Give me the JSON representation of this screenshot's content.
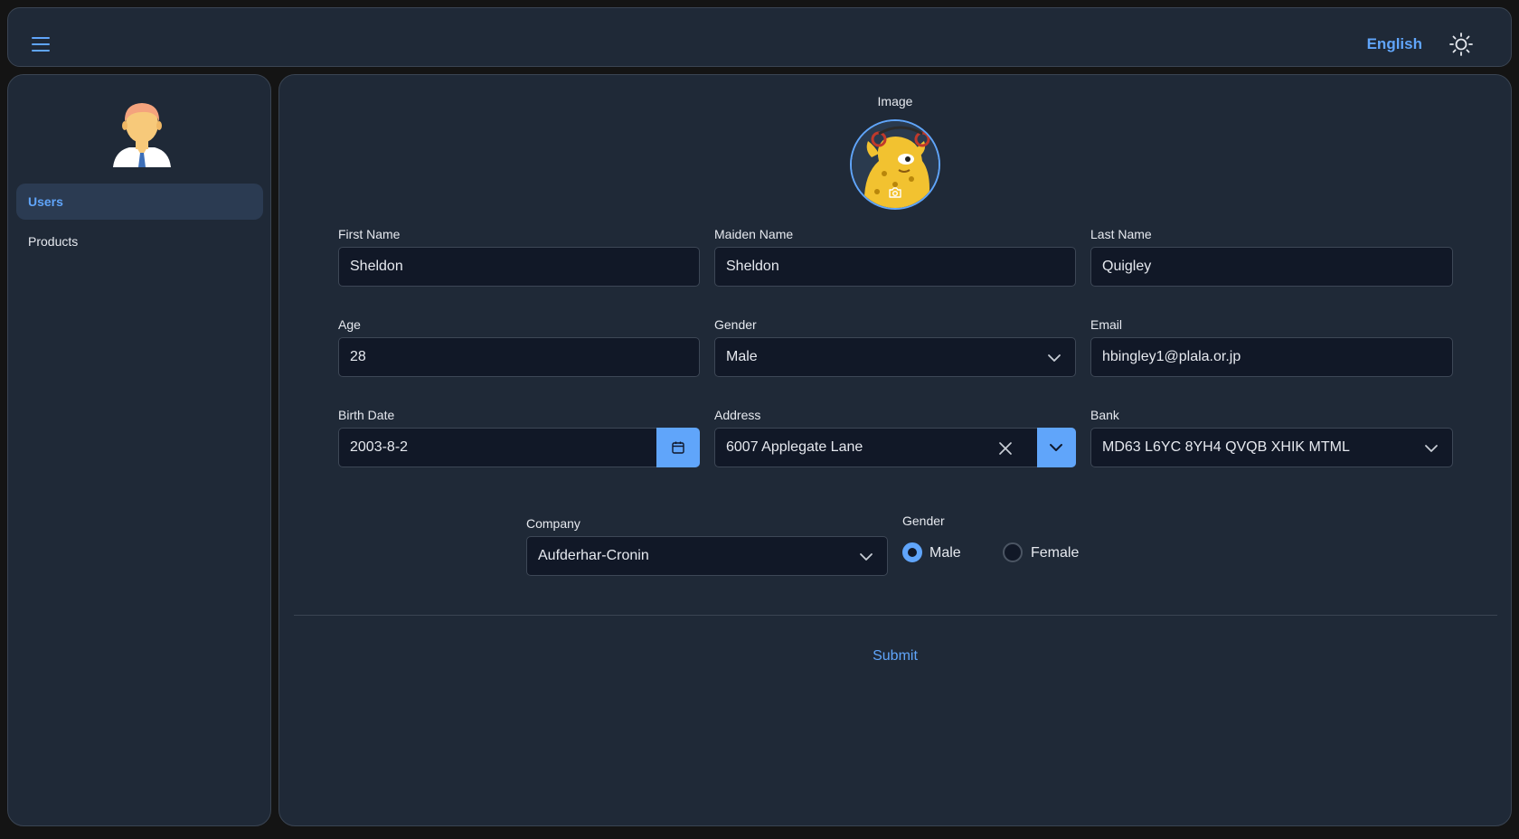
{
  "header": {
    "menu_icon": "hamburger-menu-icon",
    "language": "English",
    "theme_icon": "sun-icon"
  },
  "sidebar": {
    "avatar_icon": "user-avatar-icon",
    "items": [
      {
        "label": "Users",
        "active": true
      },
      {
        "label": "Products",
        "active": false
      }
    ]
  },
  "form": {
    "image_label": "Image",
    "camera_icon": "camera-icon",
    "first_name": {
      "label": "First Name",
      "value": "Sheldon"
    },
    "maiden_name": {
      "label": "Maiden Name",
      "value": "Sheldon"
    },
    "last_name": {
      "label": "Last Name",
      "value": "Quigley"
    },
    "age": {
      "label": "Age",
      "value": "28"
    },
    "gender_select": {
      "label": "Gender",
      "value": "Male"
    },
    "email": {
      "label": "Email",
      "value": "hbingley1@plala.or.jp"
    },
    "birth_date": {
      "label": "Birth Date",
      "value": "2003-8-2"
    },
    "address": {
      "label": "Address",
      "value": "6007 Applegate Lane"
    },
    "bank": {
      "label": "Bank",
      "value": "MD63 L6YC 8YH4 QVQB XHIK MTML"
    },
    "company": {
      "label": "Company",
      "value": "Aufderhar-Cronin"
    },
    "gender_radio": {
      "label": "Gender",
      "options": [
        {
          "label": "Male",
          "checked": true
        },
        {
          "label": "Female",
          "checked": false
        }
      ]
    },
    "submit_label": "Submit"
  },
  "colors": {
    "accent": "#60a5fa",
    "panel": "#1f2937",
    "input_bg": "#111827",
    "page_bg": "#141414"
  }
}
